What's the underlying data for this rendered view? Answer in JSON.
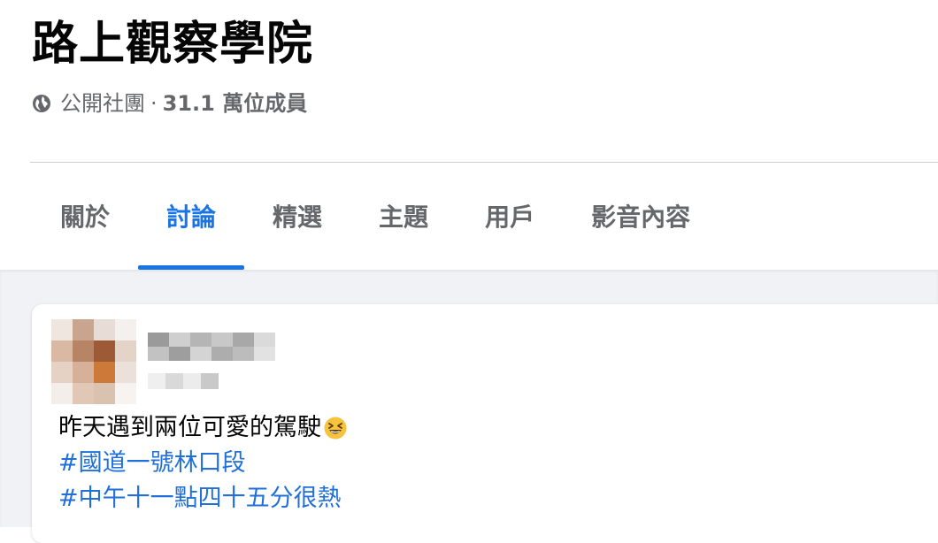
{
  "group": {
    "name": "路上觀察學院",
    "privacy": "公開社團",
    "separator": "·",
    "members": "31.1 萬位成員",
    "privacy_icon": "globe-icon"
  },
  "tabs": [
    {
      "label": "關於",
      "active": false
    },
    {
      "label": "討論",
      "active": true
    },
    {
      "label": "精選",
      "active": false
    },
    {
      "label": "主題",
      "active": false
    },
    {
      "label": "用戶",
      "active": false
    },
    {
      "label": "影音內容",
      "active": false
    }
  ],
  "post": {
    "text": "昨天遇到兩位可愛的駕駛",
    "emoji": "grinning-squinting-face-emoji",
    "hashtags": [
      "#國道一號林口段",
      "#中午十一點四十五分很熱"
    ]
  },
  "colors": {
    "accent": "#1b74e4",
    "hashtag": "#216fdb",
    "secondary_text": "#65676b",
    "feed_background": "#f0f2f5"
  }
}
